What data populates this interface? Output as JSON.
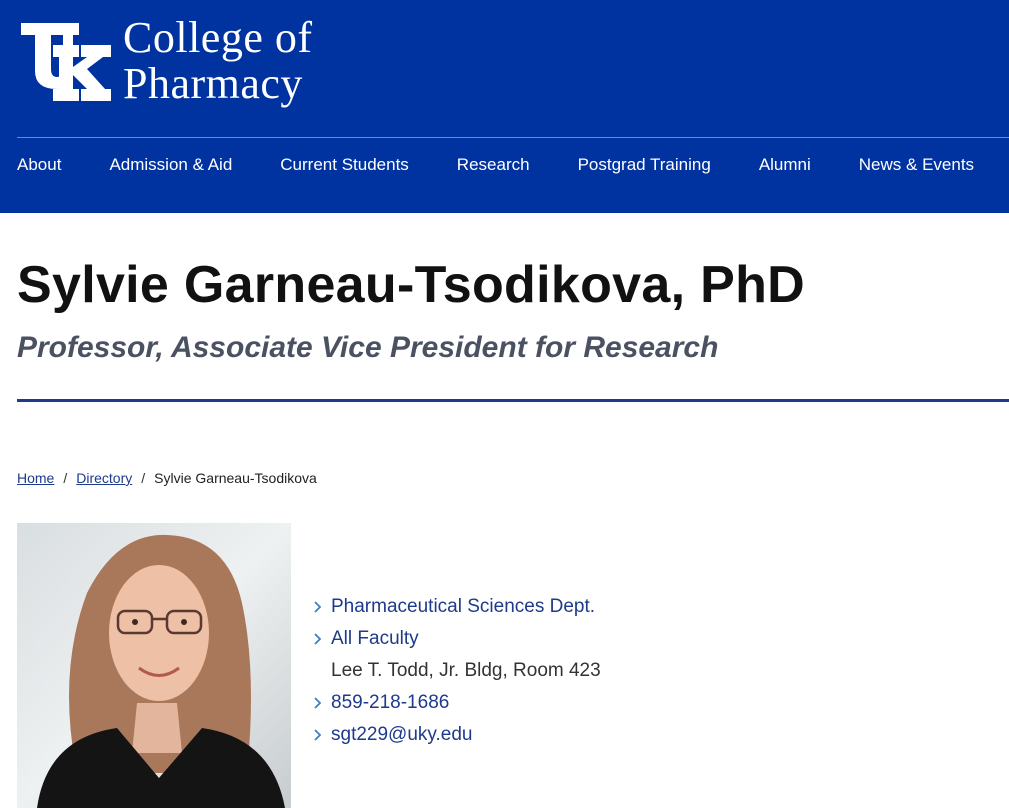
{
  "brand": {
    "mark": "UK",
    "college_line1": "College of",
    "college_line2": "Pharmacy"
  },
  "nav": [
    {
      "label": "About"
    },
    {
      "label": "Admission & Aid"
    },
    {
      "label": "Current Students"
    },
    {
      "label": "Research"
    },
    {
      "label": "Postgrad Training"
    },
    {
      "label": "Alumni"
    },
    {
      "label": "News & Events"
    }
  ],
  "profile": {
    "name": "Sylvie Garneau-Tsodikova, PhD",
    "title": "Professor, Associate Vice President for Research"
  },
  "breadcrumb": {
    "home": "Home",
    "directory": "Directory",
    "current": "Sylvie Garneau-Tsodikova",
    "separator": "/"
  },
  "contact": {
    "department": "Pharmaceutical Sciences Dept.",
    "faculty": "All Faculty",
    "office": "Lee T. Todd, Jr. Bldg, Room 423",
    "phone": "859-218-1686",
    "email": "sgt229@uky.edu"
  },
  "colors": {
    "brand_blue": "#0033a0",
    "link_blue": "#1e3a8a",
    "subtitle_gray": "#4a5160"
  },
  "icons": [
    "uk-logo-icon",
    "chevron-right-icon"
  ]
}
